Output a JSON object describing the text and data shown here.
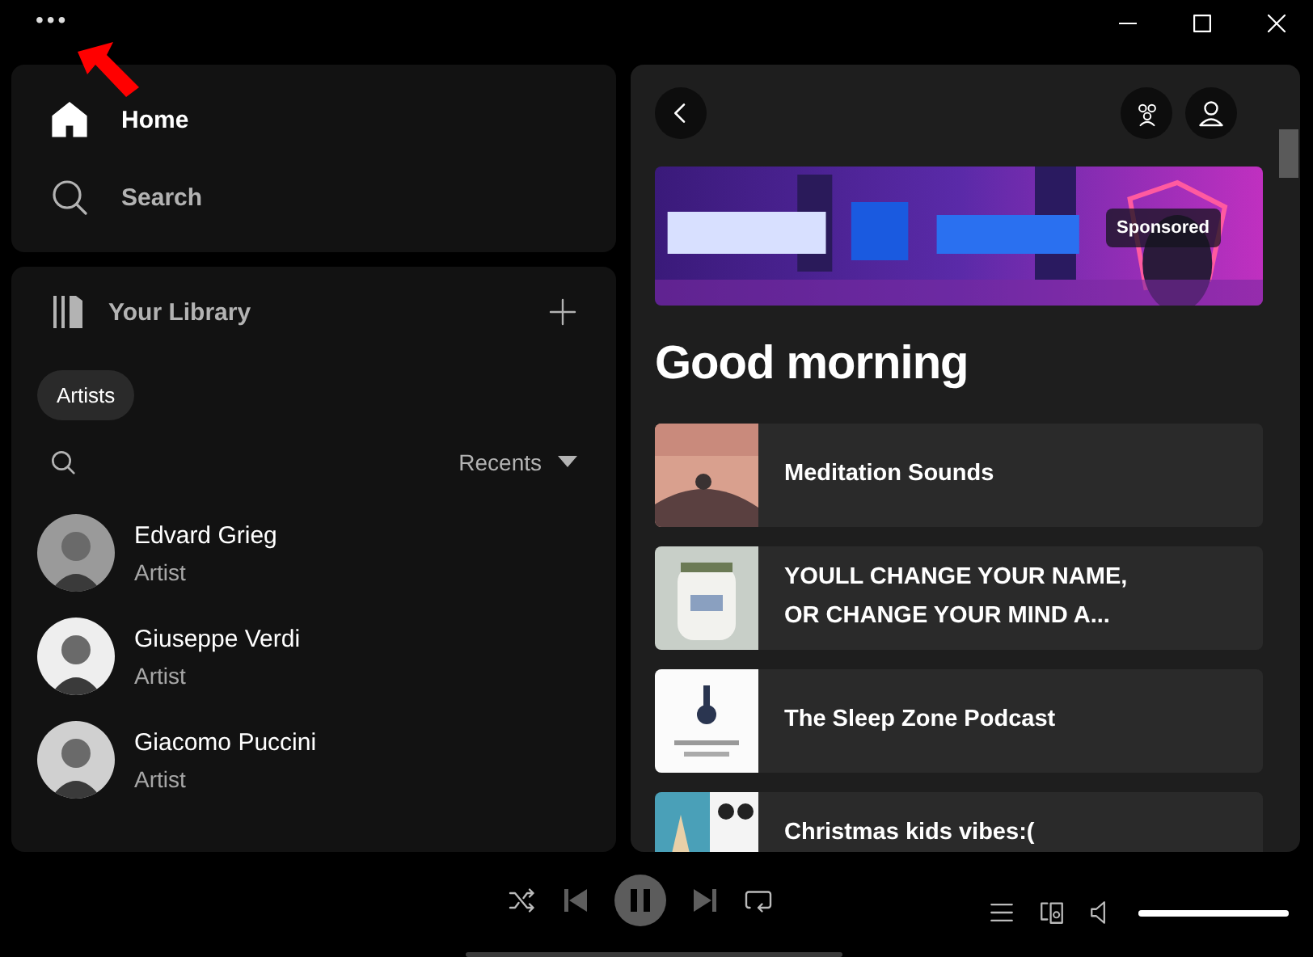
{
  "title_bar": {
    "menu_glyph": "•••"
  },
  "nav": [
    {
      "label": "Home",
      "kind": "home",
      "selected": true
    },
    {
      "label": "Search",
      "kind": "search",
      "selected": false
    }
  ],
  "library": {
    "title": "Your Library",
    "filters": [
      {
        "label": "Artists",
        "selected": true
      }
    ],
    "sort": "Recents",
    "items": [
      {
        "name": "Edvard Grieg",
        "subtitle": "Artist"
      },
      {
        "name": "Giuseppe Verdi",
        "subtitle": "Artist"
      },
      {
        "name": "Giacomo Puccini",
        "subtitle": "Artist"
      }
    ]
  },
  "main": {
    "banner": {
      "kind": "picture",
      "badge": "Sponsored"
    },
    "greeting": "Good morning",
    "shortcuts": [
      {
        "title": "Meditation Sounds"
      },
      {
        "title": "YOULL CHANGE YOUR NAME, OR CHANGE YOUR MIND A..."
      },
      {
        "title": "The Sleep Zone Podcast"
      },
      {
        "title": "Christmas kids vibes:("
      }
    ]
  },
  "player": {
    "playing": true,
    "volume": {
      "level": 1
    }
  }
}
